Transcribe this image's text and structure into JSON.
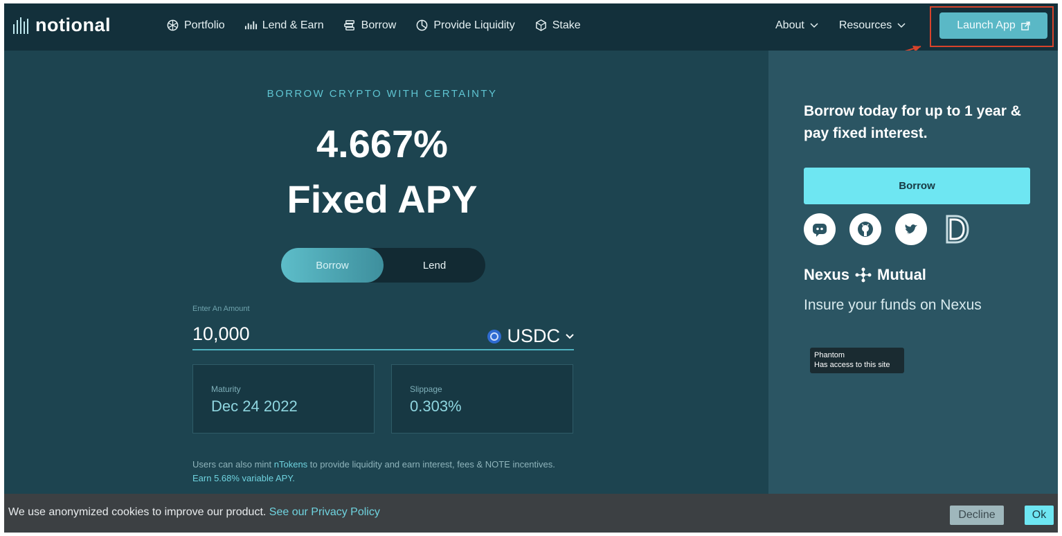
{
  "nav": {
    "logo_text": "notional",
    "links": [
      {
        "label": "Portfolio",
        "icon": "portfolio-icon"
      },
      {
        "label": "Lend & Earn",
        "icon": "lend-icon"
      },
      {
        "label": "Borrow",
        "icon": "borrow-icon"
      },
      {
        "label": "Provide Liquidity",
        "icon": "pie-chart-icon"
      },
      {
        "label": "Stake",
        "icon": "stake-icon"
      }
    ],
    "about": "About",
    "resources": "Resources",
    "launch_app": "Launch App"
  },
  "hero": {
    "eyebrow": "BORROW CRYPTO WITH CERTAINTY",
    "rate": "4.667%",
    "rate_label": "Fixed APY",
    "toggle_borrow": "Borrow",
    "toggle_lend": "Lend",
    "amount_label": "Enter An Amount",
    "amount_value": "10,000",
    "currency": "USDC",
    "maturity_label": "Maturity",
    "maturity_value": "Dec 24 2022",
    "slippage_label": "Slippage",
    "slippage_value": "0.303%",
    "note_part1": "Users can also mint ",
    "note_link1": "nTokens",
    "note_part2": " to provide liquidity and earn interest, fees & NOTE incentives. ",
    "note_link2": "Earn 5.68% variable APY."
  },
  "panel": {
    "title": "Borrow today for up to 1 year & pay fixed interest.",
    "button": "Borrow",
    "nexus_left": "Nexus",
    "nexus_right": "Mutual",
    "nexus_sub": "Insure your funds on Nexus"
  },
  "tooltip": {
    "line1": "Phantom",
    "line2": "Has access to this site"
  },
  "cookie": {
    "text": "We use anonymized cookies to improve our product. ",
    "link": "See our Privacy Policy",
    "decline": "Decline",
    "ok": "Ok"
  },
  "colors": {
    "background": "#1d4450",
    "nav": "#13303b",
    "accent": "#6ee6f2",
    "launch_button": "#5ab8c6",
    "annotation_red": "#d8432b"
  }
}
